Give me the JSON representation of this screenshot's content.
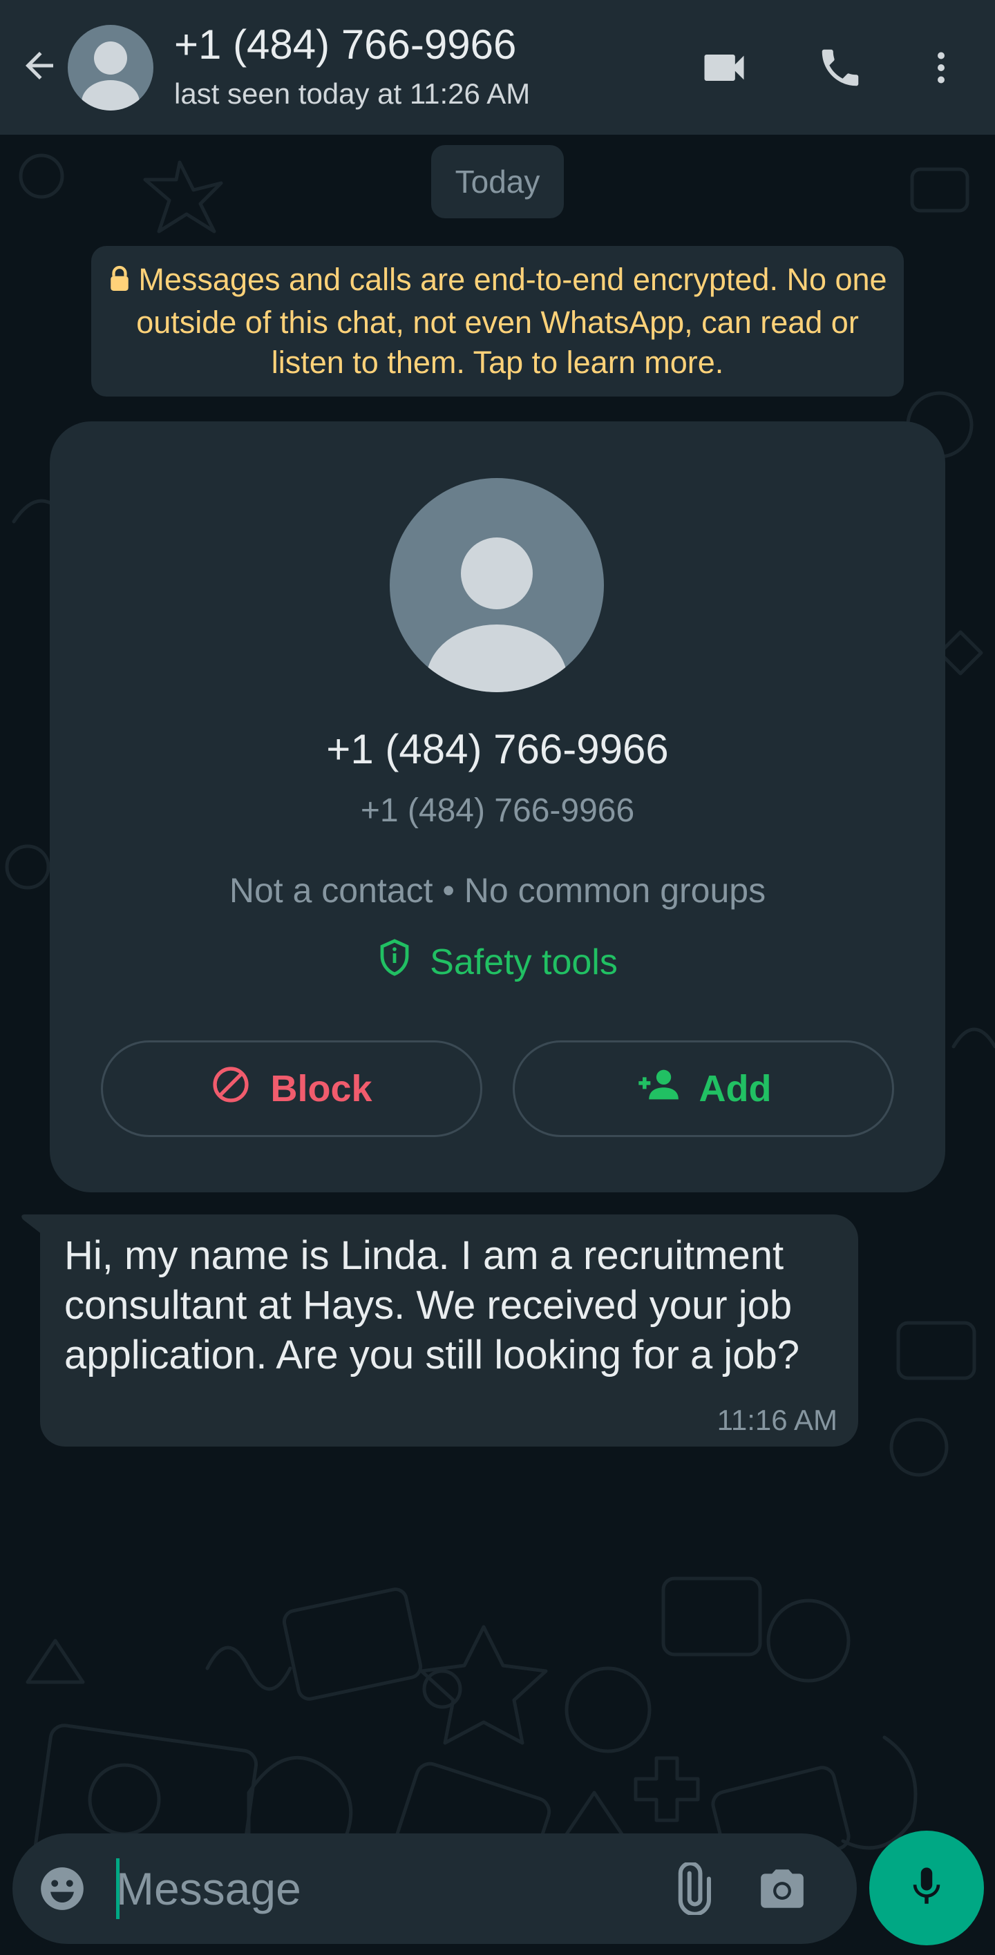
{
  "header": {
    "title": "+1 (484) 766-9966",
    "subtitle": "last seen today at 11:26 AM",
    "icons": [
      "back-arrow-icon",
      "avatar",
      "video-call-icon",
      "phone-call-icon",
      "more-vert-icon"
    ]
  },
  "chat": {
    "date_chip": "Today",
    "encryption_notice": "Messages and calls are end-to-end encrypted. No one outside of this chat, not even WhatsApp, can read or listen to them. Tap to learn more."
  },
  "contact_card": {
    "name": "+1 (484) 766-9966",
    "phone": "+1 (484) 766-9966",
    "info": "Not a contact • No common groups",
    "safety_tools_label": "Safety tools",
    "block_label": "Block",
    "add_label": "Add"
  },
  "messages": [
    {
      "text": "Hi, my name is Linda. I am a recruitment consultant at Hays. We received your job application. Are you still looking for a job?",
      "time": "11:16 AM",
      "direction": "incoming"
    }
  ],
  "composer": {
    "placeholder": "Message"
  },
  "colors": {
    "background": "#0b141a",
    "header": "#1f2c34",
    "bubble": "#202c33",
    "accent_green": "#00a884",
    "link_green": "#21c063",
    "danger_red": "#f15c6d",
    "notice_yellow": "#ffd279",
    "muted_text": "#8696a0"
  }
}
